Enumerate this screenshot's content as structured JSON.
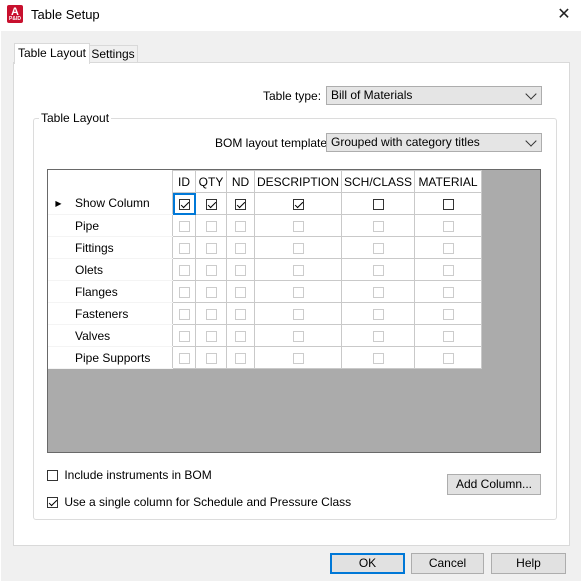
{
  "window": {
    "title": "Table Setup",
    "app_icon_letter": "A",
    "app_icon_sub": "P&ID",
    "close_glyph": "✕"
  },
  "tabs": [
    {
      "label": "Table Layout",
      "active": true
    },
    {
      "label": "Settings",
      "active": false
    }
  ],
  "table_type": {
    "label": "Table type:",
    "value": "Bill of Materials"
  },
  "group": {
    "legend": "Table Layout"
  },
  "bom_template": {
    "label": "BOM layout template:",
    "value": "Grouped with category titles"
  },
  "grid": {
    "columns": [
      "ID",
      "QTY",
      "ND",
      "DESCRIPTION",
      "SCH/CLASS",
      "MATERIAL"
    ],
    "current_row_indicator": "▶",
    "rows": [
      {
        "name": "Show Column",
        "enabled": true,
        "checks": [
          true,
          true,
          true,
          true,
          false,
          false
        ]
      },
      {
        "name": "Pipe",
        "enabled": false,
        "checks": [
          false,
          false,
          false,
          false,
          false,
          false
        ]
      },
      {
        "name": "Fittings",
        "enabled": false,
        "checks": [
          false,
          false,
          false,
          false,
          false,
          false
        ]
      },
      {
        "name": "Olets",
        "enabled": false,
        "checks": [
          false,
          false,
          false,
          false,
          false,
          false
        ]
      },
      {
        "name": "Flanges",
        "enabled": false,
        "checks": [
          false,
          false,
          false,
          false,
          false,
          false
        ]
      },
      {
        "name": "Fasteners",
        "enabled": false,
        "checks": [
          false,
          false,
          false,
          false,
          false,
          false
        ]
      },
      {
        "name": "Valves",
        "enabled": false,
        "checks": [
          false,
          false,
          false,
          false,
          false,
          false
        ]
      },
      {
        "name": "Pipe Supports",
        "enabled": false,
        "checks": [
          false,
          false,
          false,
          false,
          false,
          false
        ]
      }
    ]
  },
  "options": {
    "include_instruments": {
      "label": "Include instruments in BOM",
      "checked": false
    },
    "single_column": {
      "label": "Use a single column for Schedule and Pressure Class",
      "checked": true
    }
  },
  "buttons": {
    "add_column": "Add Column...",
    "ok": "OK",
    "cancel": "Cancel",
    "help": "Help"
  },
  "colors": {
    "accent": "#0078d7",
    "icon_red": "#c8102e",
    "grid_bg": "#ababab"
  }
}
